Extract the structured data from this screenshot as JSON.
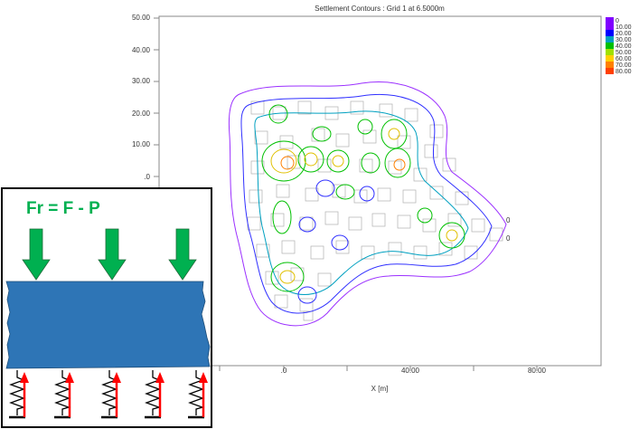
{
  "plot": {
    "title": "Settlement Contours : Grid 1 at 6.5000m",
    "xlabel": "X [m]",
    "y_ticks": [
      "50.00",
      "40.00",
      "30.00",
      "20.00",
      "10.00",
      ".0"
    ],
    "x_ticks": [
      ".0",
      "40.00",
      "80.00"
    ],
    "contour_labels": [
      "0",
      "0"
    ]
  },
  "legend": {
    "levels": [
      "0",
      "10.00",
      "20.00",
      "30.00",
      "40.00",
      "50.00",
      "60.00",
      "70.00",
      "80.00"
    ],
    "colors": [
      "#8000ff",
      "#8000ff",
      "#0000ff",
      "#00a0c0",
      "#00c000",
      "#a0e000",
      "#ffd000",
      "#ff8000",
      "#ff4000"
    ]
  },
  "inset": {
    "formula": "Fr = F - P",
    "formula_color": "#00b050",
    "block_color": "#2e75b6",
    "arrow_down_color": "#00b050",
    "reaction_arrow_color": "#ff0000"
  }
}
